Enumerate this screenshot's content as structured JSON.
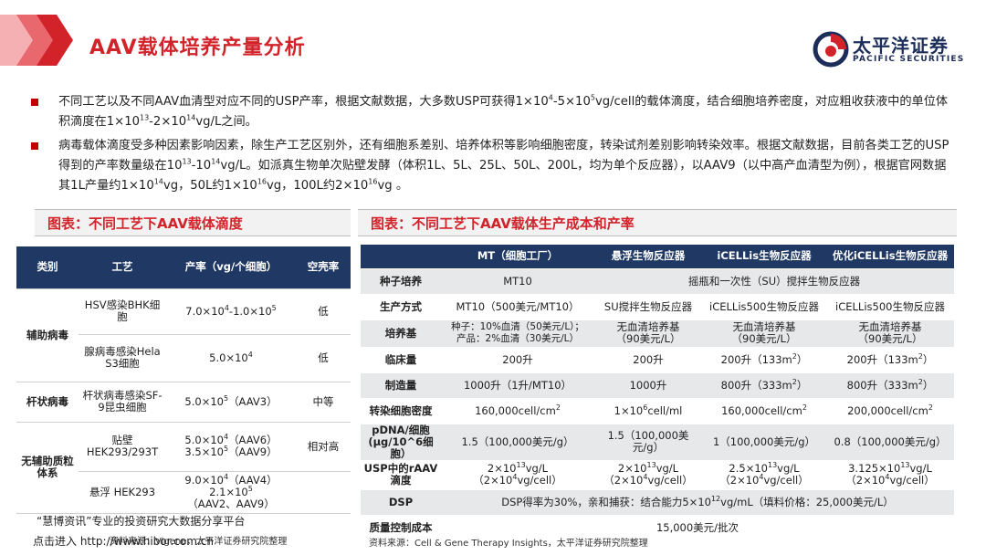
{
  "page_title": "AAV载体培养产量分析",
  "logo": {
    "cn": "太平洋证券",
    "en": "PACIFIC SECURITIES"
  },
  "colors": {
    "accent_red": "#d2232a",
    "header_navy": "#1f3864",
    "bullet_red": "#c00000"
  },
  "bullets": [
    {
      "p1": "不同工艺以及不同AAV血清型对应不同的USP产率，根据文献数据，大多数USP可获得1×10",
      "s1": "4",
      "p2": "-5×10",
      "s2": "5",
      "p3": "vg/cell的载体滴度，结合细胞培养密度，对应粗收获液中的单位体积滴度在1×10",
      "s3": "13",
      "p4": "-2×10",
      "s4": "14",
      "p5": "vg/L之间。"
    },
    {
      "p1": "病毒载体滴度受多种因素影响因素，除生产工艺区别外，还有细胞系差别、培养体积等影响细胞密度，转染试剂差别影响转染效率。根据文献数据，目前各类工艺的USP得到的产率数量级在10",
      "s1": "13",
      "p2": "-10",
      "s2": "14",
      "p3": "vg/L。如派真生物单次贴壁发酵（体积1L、5L、25L、50L、200L，均为单个反应器），以AAV9（以中高产血清型为例），根据官网数据其1L产量约1×10",
      "s3": "14",
      "p4": "vg，50L约1×10",
      "s4": "16",
      "p5": "vg，100L约2×10",
      "s5": "16",
      "p6": "vg 。"
    }
  ],
  "fig1": {
    "title": "图表：不同工艺下AAV载体滴度",
    "headers": [
      "类别",
      "工艺",
      "产率（vg/个细胞）",
      "空壳率"
    ],
    "rows": [
      {
        "cat": "辅助病毒",
        "proc": "HSV感染BHK细胞",
        "rate_a": "7.0×10",
        "rate_sa": "4",
        "rate_b": "-1.0×10",
        "rate_sb": "5",
        "empty": "低"
      },
      {
        "proc": "腺病毒感染Hela S3细胞",
        "rate_a": "5.0×10",
        "rate_sa": "4",
        "empty": "低"
      },
      {
        "cat": "杆状病毒",
        "proc": "杆状病毒感染SF-9昆虫细胞",
        "rate_a": "5.0×10",
        "rate_sa": "5",
        "rate_b": "（AAV3）",
        "empty": "中等"
      },
      {
        "cat": "无辅助质粒体系",
        "proc": "贴壁HEK293/293T",
        "l1a": "5.0×10",
        "l1s": "4",
        "l1b": "（AAV6）",
        "l2a": "3.5×10",
        "l2s": "5",
        "l2b": "（AAV9）",
        "empty": "相对高"
      },
      {
        "proc": "悬浮 HEK293",
        "l1a": "9.0×10",
        "l1s": "4",
        "l1b": "（AAV4）",
        "l2a": "2.1×10",
        "l2s": "5",
        "l2b": "（AAV2、AAV9）",
        "empty": ""
      }
    ],
    "source": "资料来源：Vigene，太平洋证券研究院整理"
  },
  "fig2": {
    "title": "图表：不同工艺下AAV载体生产成本和产率",
    "headers": [
      "",
      "MT（细胞工厂）",
      "悬浮生物反应器",
      "iCELLis生物反应器",
      "优化iCELLis生物反应器"
    ],
    "rows": {
      "seed": {
        "label": "种子培养",
        "mt": "MT10",
        "others": "摇瓶和一次性（SU）搅拌生物反应器"
      },
      "mode": {
        "label": "生产方式",
        "mt": "MT10（500美元/MT10）",
        "su": "SU搅拌生物反应器",
        "ic": "iCELLis500生物反应器",
        "opt": "iCELLis500生物反应器"
      },
      "medium": {
        "label": "培养基",
        "mt_l1": "种子：10%血清（50美元/L）；",
        "mt_l2": "产品：2%血清（30美元/L）",
        "su_l1": "无血清培养基",
        "su_l2": "（90美元/L）",
        "ic_l1": "无血清培养基",
        "ic_l2": "（90美元/L）",
        "opt_l1": "无血清培养基",
        "opt_l2": "（90美元/L）"
      },
      "clinical": {
        "label": "临床量",
        "mt": "200升",
        "su": "200升",
        "ic_a": "200升（133m",
        "ic_s": "2",
        "ic_b": "）",
        "opt_a": "200升（133m",
        "opt_s": "2",
        "opt_b": "）"
      },
      "mfg": {
        "label": "制造量",
        "mt": "1000升（1升/MT10）",
        "su": "1000升",
        "ic_a": "800升（333m",
        "ic_s": "2",
        "ic_b": "）",
        "opt_a": "800升（333m",
        "opt_s": "2",
        "opt_b": "）"
      },
      "density": {
        "label": "转染细胞密度",
        "mt_a": "160,000cell/cm",
        "mt_s": "2",
        "su_a": "1×10",
        "su_s": "6",
        "su_b": "cell/ml",
        "ic_a": "160,000cell/cm",
        "ic_s": "2",
        "opt_a": "200,000cell/cm",
        "opt_s": "2"
      },
      "pdna": {
        "label_l1": "pDNA/细胞",
        "label_l2": "(μg/10^6细胞）",
        "mt": "1.5（100,000美元/g）",
        "su": "1.5（100,000美元/g）",
        "ic": "1（100,000美元/g）",
        "opt": "0.8（100,000美元/g）"
      },
      "usp": {
        "label_l1": "USP中的rAAV",
        "label_l2": "滴度",
        "mt_1a": "2×10",
        "mt_1s": "13",
        "mt_1b": "vg/L",
        "mt_2a": "（2×10",
        "mt_2s": "4",
        "mt_2b": "vg/cell）",
        "su_1a": "2×10",
        "su_1s": "13",
        "su_1b": "vg/L",
        "su_2a": "（2×10",
        "su_2s": "4",
        "su_2b": "vg/cell）",
        "ic_1a": "2.5×10",
        "ic_1s": "13",
        "ic_1b": "vg/L",
        "ic_2a": "（2×10",
        "ic_2s": "4",
        "ic_2b": "vg/cell）",
        "opt_1a": "3.125×10",
        "opt_1s": "13",
        "opt_1b": "vg/L",
        "opt_2a": "（2×10",
        "opt_2s": "4",
        "opt_2b": "vg/cell）"
      },
      "dsp": {
        "label": "DSP",
        "a": "DSP得率为30%，亲和捕获：结合能力5×10",
        "s": "12",
        "b": "vg/mL（填料价格：25,000美元/L）"
      },
      "qc": {
        "label": "质量控制成本",
        "value": "15,000美元/批次"
      }
    },
    "source": "资料来源：Cell & Gene Therapy  Insights，太平洋证券研究院整理"
  },
  "watermark": {
    "line1": "“慧博资讯”专业的投资研究大数据分享平台",
    "line2": "点击进入  http://www.hibor.com.cn"
  }
}
